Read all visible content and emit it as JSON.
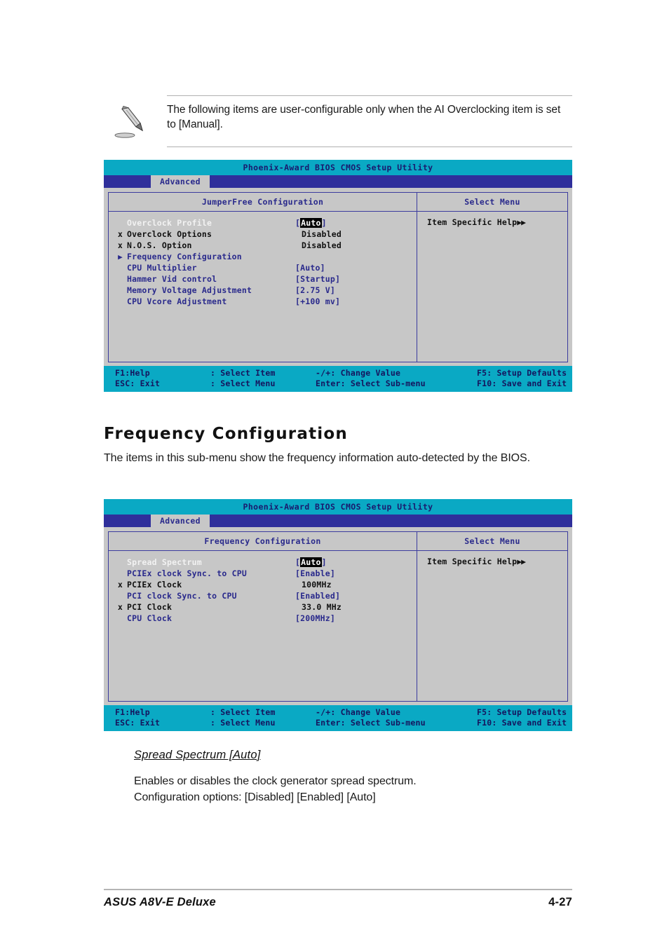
{
  "note": {
    "icon": "pencil-note-icon",
    "text": "The following items are user-configurable only when the AI Overclocking item is set to [Manual]."
  },
  "bios_screen_1": {
    "title": "Phoenix-Award BIOS CMOS Setup Utility",
    "tab": "Advanced",
    "left_panel_header": "JumperFree Configuration",
    "right_panel_header": "Select Menu",
    "help_text": "Item Specific Help",
    "help_arrows": "▶▶",
    "items": [
      {
        "mark": "",
        "label": "Overclock Profile",
        "value": "Auto",
        "value_style": "highlight",
        "label_style": "selected"
      },
      {
        "mark": "x",
        "label": "Overclock Options",
        "value": "Disabled",
        "value_style": "plain",
        "label_style": "black"
      },
      {
        "mark": "x",
        "label": "N.O.S. Option",
        "value": "Disabled",
        "value_style": "plain",
        "label_style": "black"
      },
      {
        "mark": "▶",
        "label": "Frequency Configuration",
        "value": "",
        "value_style": "none",
        "label_style": "blue"
      },
      {
        "mark": "",
        "label": "CPU Multiplier",
        "value": "[Auto]",
        "value_style": "bracket",
        "label_style": "blue"
      },
      {
        "mark": "",
        "label": "Hammer Vid control",
        "value": "[Startup]",
        "value_style": "bracket",
        "label_style": "blue"
      },
      {
        "mark": "",
        "label": "Memory Voltage Adjustment",
        "value": "[2.75 V]",
        "value_style": "bracket",
        "label_style": "blue"
      },
      {
        "mark": "",
        "label": "CPU Vcore Adjustment",
        "value": "[+100 mv]",
        "value_style": "bracket",
        "label_style": "blue"
      }
    ],
    "footer": {
      "f1_help": "F1:Help",
      "select_item": ":  Select Item",
      "change_value": "-/+:  Change Value",
      "setup_defaults": "F5:  Setup Defaults",
      "esc_exit": "ESC:  Exit",
      "select_menu": ":  Select Menu",
      "select_submenu": "Enter:  Select Sub-menu",
      "save_exit": "F10:  Save and Exit"
    }
  },
  "section": {
    "heading": "Frequency Configuration",
    "paragraph": "The items in this sub-menu show the frequency information auto-detected by the BIOS."
  },
  "bios_screen_2": {
    "title": "Phoenix-Award BIOS CMOS Setup Utility",
    "tab": "Advanced",
    "left_panel_header": "Frequency Configuration",
    "right_panel_header": "Select Menu",
    "help_text": "Item Specific Help",
    "help_arrows": "▶▶",
    "items": [
      {
        "mark": "",
        "label": "Spread Spectrum",
        "value": "Auto",
        "value_style": "highlight",
        "label_style": "selected"
      },
      {
        "mark": "",
        "label": "PCIEx clock Sync. to CPU",
        "value": "[Enable]",
        "value_style": "bracket",
        "label_style": "blue"
      },
      {
        "mark": "x",
        "label": "PCIEx Clock",
        "value": "100MHz",
        "value_style": "plain",
        "label_style": "black"
      },
      {
        "mark": "",
        "label": "PCI clock Sync. to CPU",
        "value": "[Enabled]",
        "value_style": "bracket",
        "label_style": "blue"
      },
      {
        "mark": "x",
        "label": "PCI Clock",
        "value": "33.0 MHz",
        "value_style": "plain",
        "label_style": "black"
      },
      {
        "mark": "",
        "label": "CPU Clock",
        "value": "[200MHz]",
        "value_style": "bracket",
        "label_style": "blue"
      }
    ],
    "footer": {
      "f1_help": "F1:Help",
      "select_item": ":  Select Item",
      "change_value": "-/+:  Change Value",
      "setup_defaults": "F5:  Setup Defaults",
      "esc_exit": "ESC:  Exit",
      "select_menu": ":  Select Menu",
      "select_submenu": "Enter:  Select Sub-menu",
      "save_exit": "F10:  Save and Exit"
    }
  },
  "subsection": {
    "heading": "Spread Spectrum [Auto]",
    "line1": "Enables or disables the clock generator spread spectrum.",
    "line2": "Configuration options: [Disabled] [Enabled] [Auto]"
  },
  "page_footer": {
    "product": "ASUS A8V-E Deluxe",
    "page_number": "4-27"
  },
  "colors": {
    "header_cyan": "#0aa9c4",
    "menubar_blue": "#2f2f9b",
    "panel_gray": "#c7c7c7",
    "text_blue": "#2a2a8c",
    "border_blue": "#3b3b9e"
  }
}
